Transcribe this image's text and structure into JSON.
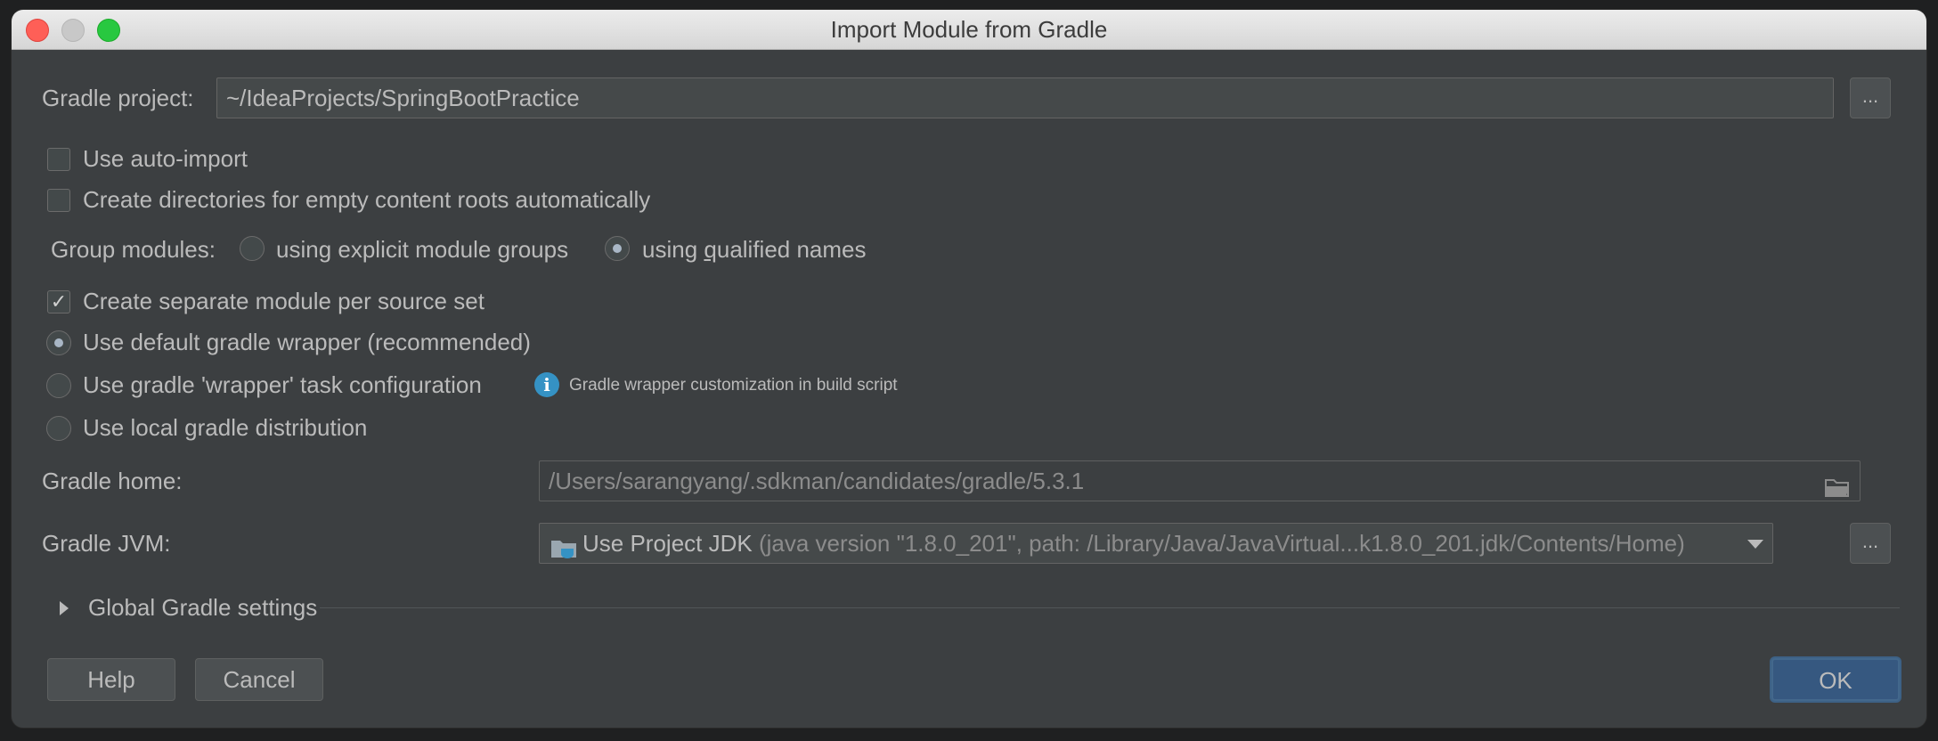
{
  "window": {
    "title": "Import Module from Gradle"
  },
  "gradle_project": {
    "label": "Gradle project:",
    "value": "~/IdeaProjects/SpringBootPractice",
    "browse_label": "..."
  },
  "options": {
    "auto_import": {
      "label": "Use auto-import",
      "checked": false
    },
    "create_dirs": {
      "label": "Create directories for empty content roots automatically",
      "checked": false
    },
    "group_modules": {
      "label": "Group modules:",
      "explicit": {
        "prefix": "using explicit module ",
        "underlined": "g",
        "suffix": "roups",
        "selected": false
      },
      "qualified": {
        "prefix": "using ",
        "underlined": "q",
        "suffix": "ualified names",
        "selected": true
      }
    },
    "separate_module": {
      "label": "Create separate module per source set",
      "checked": true
    },
    "default_wrapper": {
      "label": "Use default gradle wrapper (recommended)",
      "selected": true
    },
    "wrapper_task": {
      "label": "Use gradle 'wrapper' task configuration",
      "selected": false
    },
    "wrapper_hint": "Gradle wrapper customization in build script",
    "local_distribution": {
      "label": "Use local gradle distribution",
      "selected": false
    }
  },
  "gradle_home": {
    "label": "Gradle home:",
    "value": "/Users/sarangyang/.sdkman/candidates/gradle/5.3.1"
  },
  "gradle_jvm": {
    "label": "Gradle JVM:",
    "value_main": "Use Project JDK",
    "value_detail": "(java version \"1.8.0_201\", path: /Library/Java/JavaVirtual...k1.8.0_201.jdk/Contents/Home)",
    "browse_label": "..."
  },
  "global_settings": {
    "label": "Global Gradle settings",
    "expanded": false
  },
  "buttons": {
    "help": "Help",
    "cancel": "Cancel",
    "ok": "OK"
  },
  "icons": {
    "browse_folder": "folder-icon",
    "jdk": "jdk-folder-icon",
    "dropdown": "chevron-down-icon",
    "expand": "triangle-right-icon",
    "info": "info-icon"
  },
  "colors": {
    "background": "#3c3f41",
    "field": "#45494a",
    "accent": "#365880",
    "info": "#3592c4"
  }
}
